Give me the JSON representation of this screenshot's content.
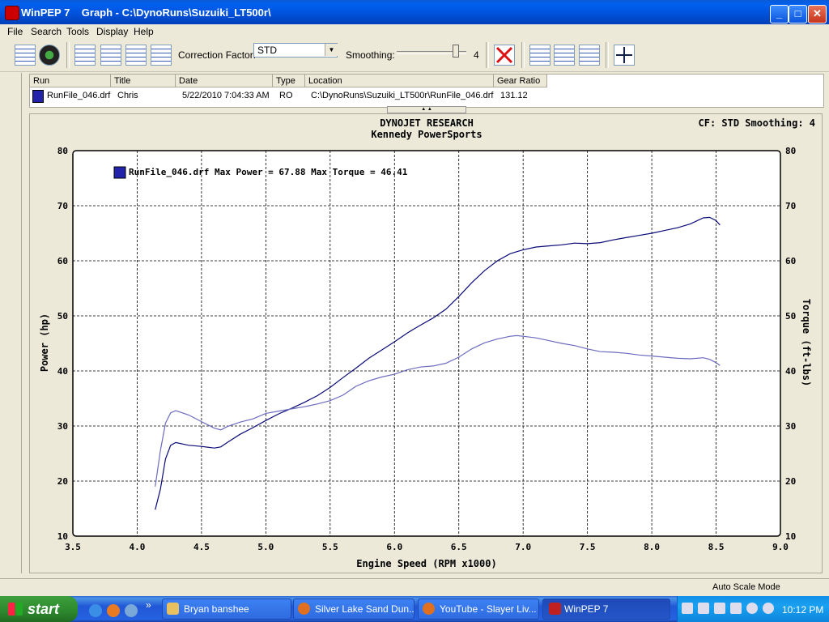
{
  "window": {
    "title": "WinPEP 7    Graph - C:\\DynoRuns\\Suzuiki_LT500r\\",
    "minimize": "_",
    "maximize": "□",
    "close": "✕"
  },
  "menu": [
    "File",
    "Search",
    "Tools",
    "Display",
    "Help"
  ],
  "toolbar": {
    "correction_label": "Correction Factor:",
    "correction_value": "STD",
    "smoothing_label": "Smoothing:",
    "smoothing_value": "4",
    "smoothing_level": 4
  },
  "run_table": {
    "headers": [
      "Run",
      "Title",
      "Date",
      "Type",
      "Location",
      "Gear Ratio"
    ],
    "row": {
      "run": "RunFile_046.drf",
      "title": "Chris",
      "date": "5/22/2010 7:04:33 AM",
      "type": "RO",
      "location": "C:\\DynoRuns\\Suzuiki_LT500r\\RunFile_046.drf",
      "gear_ratio": "131.12",
      "color": "#2222aa"
    }
  },
  "graph": {
    "title_line1": "DYNOJET RESEARCH",
    "title_line2": "Kennedy PowerSports",
    "cf_info": "CF: STD  Smoothing: 4",
    "legend": "RunFile_046.drf Max Power = 67.88 Max Torque = 46.41"
  },
  "chart_data": {
    "type": "line",
    "xlabel": "Engine Speed (RPM x1000)",
    "ylabel": "Power (hp)",
    "y2label": "Torque (ft-lbs)",
    "xlim": [
      3.5,
      9.0
    ],
    "ylim": [
      10,
      80
    ],
    "y2lim": [
      10,
      80
    ],
    "x_ticks": [
      "3.5",
      "4.0",
      "4.5",
      "5.0",
      "5.5",
      "6.0",
      "6.5",
      "7.0",
      "7.5",
      "8.0",
      "8.5",
      "9.0"
    ],
    "y_ticks": [
      "10",
      "20",
      "30",
      "40",
      "50",
      "60",
      "70",
      "80"
    ],
    "grid": true,
    "series": [
      {
        "color": "#0a0a78",
        "x": [
          4.14,
          4.18,
          4.22,
          4.26,
          4.3,
          4.4,
          4.5,
          4.6,
          4.65,
          4.7,
          4.8,
          4.9,
          5.0,
          5.1,
          5.2,
          5.3,
          5.4,
          5.5,
          5.6,
          5.7,
          5.8,
          5.9,
          6.0,
          6.1,
          6.2,
          6.3,
          6.4,
          6.5,
          6.6,
          6.7,
          6.8,
          6.9,
          7.0,
          7.1,
          7.2,
          7.3,
          7.4,
          7.5,
          7.6,
          7.7,
          7.8,
          7.9,
          8.0,
          8.1,
          8.2,
          8.3,
          8.4,
          8.45,
          8.5,
          8.53
        ],
        "values": [
          14.8,
          18.5,
          24.0,
          26.5,
          27.0,
          26.5,
          26.3,
          26.0,
          26.2,
          27.0,
          28.5,
          29.7,
          31.0,
          32.2,
          33.2,
          34.3,
          35.5,
          37.0,
          38.8,
          40.5,
          42.3,
          43.8,
          45.3,
          46.9,
          48.3,
          49.6,
          51.2,
          53.5,
          56.0,
          58.2,
          60.0,
          61.3,
          62.0,
          62.5,
          62.7,
          62.9,
          63.2,
          63.1,
          63.3,
          63.8,
          64.2,
          64.6,
          65.0,
          65.5,
          66.0,
          66.7,
          67.8,
          67.88,
          67.3,
          66.5
        ]
      },
      {
        "color": "#6b6bbf",
        "x": [
          4.14,
          4.18,
          4.22,
          4.26,
          4.3,
          4.4,
          4.5,
          4.6,
          4.65,
          4.7,
          4.8,
          4.9,
          5.0,
          5.1,
          5.2,
          5.3,
          5.4,
          5.5,
          5.6,
          5.7,
          5.8,
          5.9,
          6.0,
          6.1,
          6.2,
          6.3,
          6.4,
          6.5,
          6.6,
          6.7,
          6.8,
          6.9,
          6.95,
          7.0,
          7.1,
          7.2,
          7.3,
          7.4,
          7.5,
          7.6,
          7.7,
          7.8,
          7.9,
          8.0,
          8.1,
          8.2,
          8.3,
          8.4,
          8.45,
          8.5,
          8.53
        ],
        "values": [
          19.0,
          25.5,
          30.5,
          32.4,
          32.8,
          32.0,
          30.8,
          29.6,
          29.3,
          29.9,
          30.7,
          31.3,
          32.3,
          32.7,
          33.1,
          33.5,
          34.0,
          34.6,
          35.6,
          37.2,
          38.2,
          38.9,
          39.4,
          40.2,
          40.7,
          40.9,
          41.4,
          42.5,
          44.0,
          45.1,
          45.8,
          46.3,
          46.41,
          46.3,
          46.0,
          45.5,
          45.0,
          44.6,
          44.0,
          43.5,
          43.4,
          43.2,
          42.9,
          42.7,
          42.5,
          42.3,
          42.2,
          42.4,
          42.1,
          41.5,
          41.0
        ]
      }
    ]
  },
  "status": "Auto Scale Mode",
  "taskbar": {
    "start": "start",
    "tasks": [
      {
        "label": "Bryan banshee",
        "icon_color": "#e8c060",
        "active": false
      },
      {
        "label": "Silver Lake Sand Dun...",
        "icon_color": "#e07020",
        "active": false
      },
      {
        "label": "YouTube - Slayer Liv...",
        "icon_color": "#e07020",
        "active": false
      },
      {
        "label": "WinPEP 7",
        "icon_color": "#c02020",
        "active": true
      }
    ],
    "clock": "10:12 PM"
  }
}
